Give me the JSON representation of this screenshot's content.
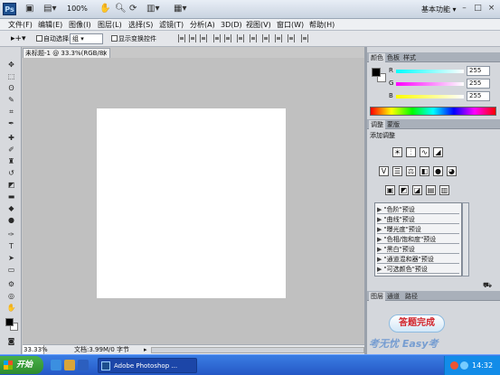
{
  "titlebar": {
    "app_logo": "Ps",
    "zoom": "100%",
    "workspace": "基本功能",
    "workspace_arrow": "▾",
    "minimize": "–",
    "maximize": "□",
    "close": "×"
  },
  "menubar": {
    "items": [
      "文件(F)",
      "编辑(E)",
      "图像(I)",
      "图层(L)",
      "选择(S)",
      "滤镜(T)",
      "分析(A)",
      "3D(D)",
      "视图(V)",
      "窗口(W)",
      "帮助(H)"
    ]
  },
  "optionsbar": {
    "auto_select_label": "自动选择:",
    "auto_select_value": "组",
    "show_transform_label": "显示变换控件"
  },
  "document": {
    "tab_title": "未标题-1 @ 33.3%(RGB/8)",
    "tab_close": "×",
    "canvas_color": "#ffffff",
    "status_zoom": "33.33%",
    "status_info": "文档:3.99M/0 字节",
    "status_arrow": "▸"
  },
  "color_panel": {
    "tabs": [
      "颜色",
      "色板",
      "样式"
    ],
    "r_label": "R",
    "g_label": "G",
    "b_label": "B",
    "r_value": "255",
    "g_value": "255",
    "b_value": "255"
  },
  "adjustments_panel": {
    "tabs": [
      "调整",
      "蒙版"
    ],
    "heading": "添加调整",
    "presets": [
      "\"色阶\"预设",
      "\"曲线\"预设",
      "\"曝光度\"预设",
      "\"色相/饱和度\"预设",
      "\"黑白\"预设",
      "\"通道混和器\"预设",
      "\"可选颜色\"预设"
    ]
  },
  "layers_panel": {
    "tabs": [
      "图层",
      "通道",
      "路径"
    ],
    "answer_button": "答题完成",
    "watermark": "考无忧 Easy考"
  },
  "taskbar": {
    "start_label": "开始",
    "task_label": "Adobe Photoshop ...",
    "clock": "14:32"
  },
  "colors": {
    "accent": "#2558c6",
    "panel_bg": "#d4d7dc",
    "answer_text": "#d2252c"
  }
}
